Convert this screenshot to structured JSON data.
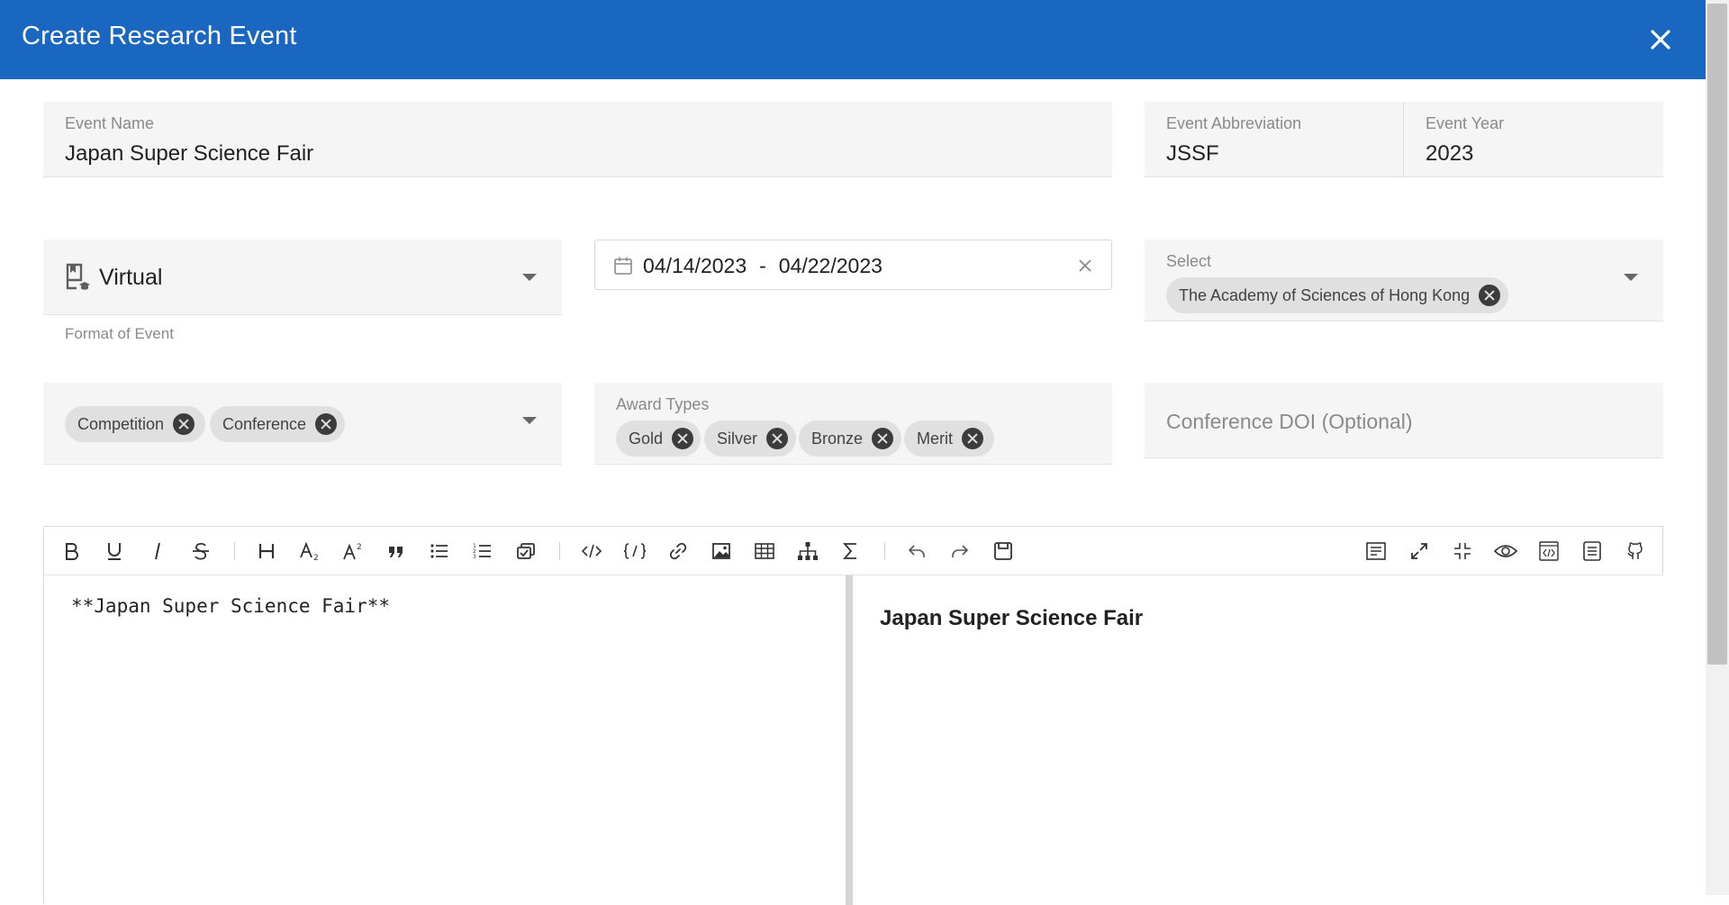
{
  "dialog": {
    "title": "Create Research Event"
  },
  "form": {
    "event_name": {
      "label": "Event Name",
      "value": "Japan Super Science Fair"
    },
    "event_abbreviation": {
      "label": "Event Abbreviation",
      "value": "JSSF"
    },
    "event_year": {
      "label": "Event Year",
      "value": "2023"
    },
    "format": {
      "value": "Virtual",
      "hint": "Format of Event",
      "icon": "virtual-event-icon"
    },
    "date_range": {
      "start": "04/14/2023",
      "separator": "-",
      "end": "04/22/2023"
    },
    "organizer": {
      "label": "Select",
      "chips": [
        "The Academy of Sciences of Hong Kong"
      ]
    },
    "event_types": {
      "chips": [
        "Competition",
        "Conference"
      ]
    },
    "award_types": {
      "label": "Award Types",
      "chips": [
        "Gold",
        "Silver",
        "Bronze",
        "Merit"
      ]
    },
    "conference_doi": {
      "placeholder": "Conference DOI (Optional)"
    }
  },
  "editor": {
    "toolbar_icons": [
      "bold-icon",
      "underline-icon",
      "italic-icon",
      "strikethrough-icon",
      "heading-icon",
      "subscript-icon",
      "superscript-icon",
      "quote-icon",
      "unordered-list-icon",
      "ordered-list-icon",
      "checklist-icon",
      "code-icon",
      "code-block-icon",
      "link-icon",
      "image-icon",
      "table-icon",
      "diagram-icon",
      "formula-icon",
      "undo-icon",
      "redo-icon",
      "save-icon",
      "catalog-icon",
      "page-fullscreen-icon",
      "fullscreen-icon",
      "preview-icon",
      "html-preview-icon",
      "outline-icon",
      "github-icon"
    ],
    "source_text": "**Japan Super Science Fair**",
    "preview_text": "Japan Super Science Fair"
  },
  "colors": {
    "header": "#1a67c1",
    "field_bg": "#f5f5f5",
    "chip_bg": "#e0e0e0"
  }
}
